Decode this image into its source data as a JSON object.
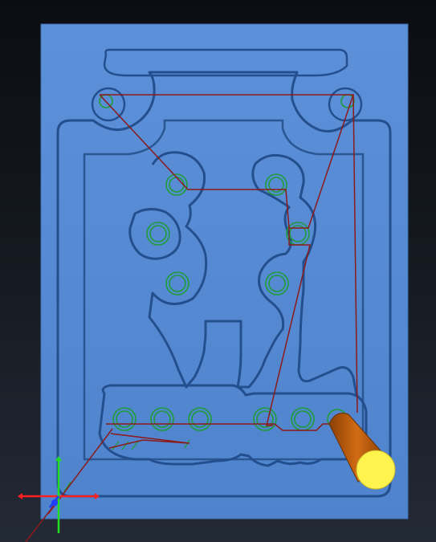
{
  "viewport": {
    "background_top": "#0b0d12",
    "background_bottom": "#232a36"
  },
  "stock": {
    "color": "#5b8fd6",
    "edge_color": "#1f4e8c",
    "shadow_color": "#2d5f9f"
  },
  "toolpath": {
    "rapid_color": "#8b1a1a",
    "cut_color": "#1f9c3a"
  },
  "tool": {
    "shank_color": "#c0600e",
    "tip_color": "#fff34d"
  },
  "axis_triad": {
    "x_color": "#ff2020",
    "y_color": "#22dd22",
    "z_color": "#2040ff"
  }
}
